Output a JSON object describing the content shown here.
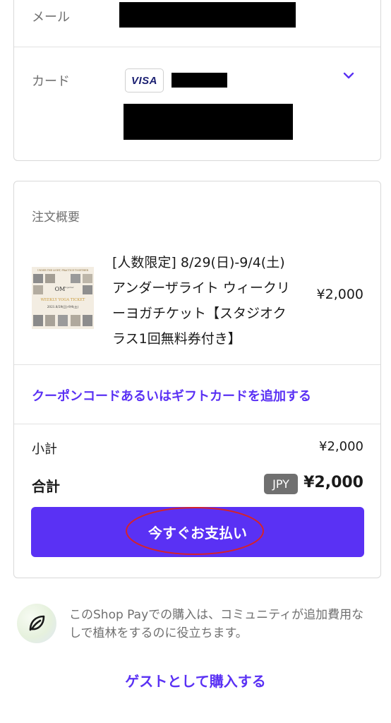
{
  "colors": {
    "accent": "#5a31f4",
    "muted_text": "#707070",
    "border": "#d9d9d9",
    "annotation": "#d4232b"
  },
  "contact": {
    "email_label": "メール",
    "card_label": "カード",
    "card_brand": "VISA"
  },
  "summary": {
    "heading": "注文概要",
    "product": {
      "title": "[人数限定] 8/29(日)-9/4(土) アンダーザライト ウィークリーヨガチケット【スタジオクラス1回無料券付き】",
      "price": "¥2,000",
      "image_banner": "UNDER THE LIGHT, PRACTICE TOGETHER",
      "image_logo": "OM",
      "image_logo_sub": "Together",
      "image_title": "WEEKLY YOGA TICKET",
      "image_dates": "2021.8/29(日)-9/4(土)"
    },
    "coupon_link": "クーポンコードあるいはギフトカードを追加する",
    "subtotal_label": "小計",
    "subtotal_value": "¥2,000",
    "total_label": "合計",
    "currency": "JPY",
    "total_value": "¥2,000",
    "pay_button": "今すぐお支払い"
  },
  "shop_pay": {
    "icon": "leaf-icon",
    "note": "このShop Payでの購入は、コミュニティが追加費用なしで植林をするのに役立ちます。"
  },
  "guest_link": "ゲストとして購入する"
}
